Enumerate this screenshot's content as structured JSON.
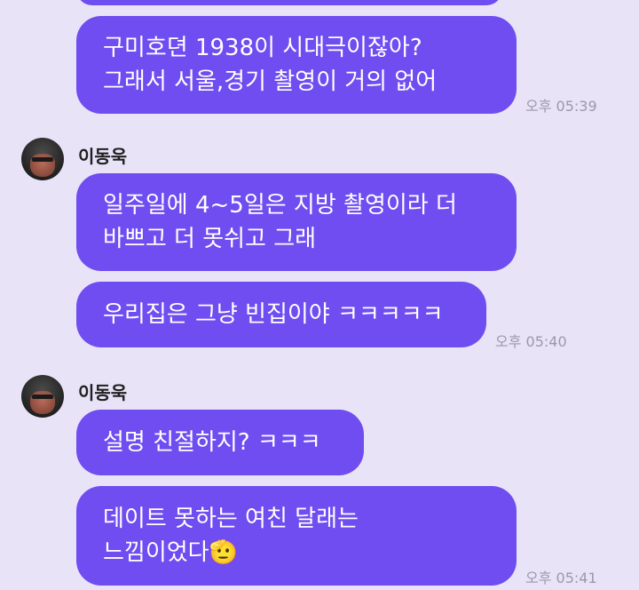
{
  "messages": [
    {
      "text": "구미호뎐 1938이 시대극이잖아?\n그래서 서울,경기 촬영이 거의 없어"
    },
    {
      "text": "일주일에 4~5일은 지방 촬영이라 더\n바쁘고 더 못쉬고 그래"
    },
    {
      "text": "우리집은 그냥 빈집이야 ㅋㅋㅋㅋㅋ"
    },
    {
      "text": "설명 친절하지? ㅋㅋㅋ"
    },
    {
      "text": "데이트 못하는 여친 달래는\n느낌이었다🫡"
    }
  ],
  "times": [
    "오후 05:39",
    "오후 05:40",
    "오후 05:41"
  ],
  "sender": {
    "name": "이동욱"
  },
  "colors": {
    "bubble": "#6f4df0",
    "background": "#e9e3f8",
    "time": "#9d98a8"
  }
}
